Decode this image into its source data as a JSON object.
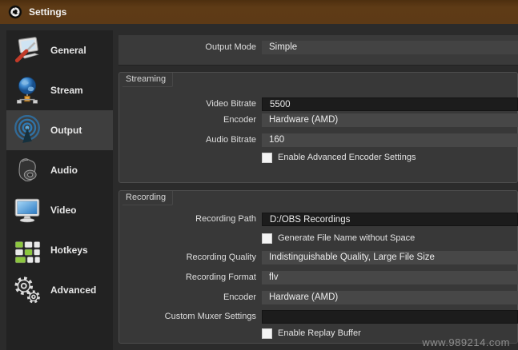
{
  "window": {
    "title": "Settings"
  },
  "sidebar": {
    "items": [
      {
        "label": "General",
        "icon": "general-icon",
        "selected": false
      },
      {
        "label": "Stream",
        "icon": "stream-icon",
        "selected": false
      },
      {
        "label": "Output",
        "icon": "output-icon",
        "selected": true
      },
      {
        "label": "Audio",
        "icon": "audio-icon",
        "selected": false
      },
      {
        "label": "Video",
        "icon": "video-icon",
        "selected": false
      },
      {
        "label": "Hotkeys",
        "icon": "hotkeys-icon",
        "selected": false
      },
      {
        "label": "Advanced",
        "icon": "advanced-icon",
        "selected": false
      }
    ]
  },
  "main": {
    "output_mode": {
      "label": "Output Mode",
      "value": "Simple"
    },
    "streaming": {
      "title": "Streaming",
      "video_bitrate": {
        "label": "Video Bitrate",
        "value": "5500"
      },
      "encoder": {
        "label": "Encoder",
        "value": "Hardware (AMD)"
      },
      "audio_bitrate": {
        "label": "Audio Bitrate",
        "value": "160"
      },
      "advanced_encoder_checkbox": {
        "label": "Enable Advanced Encoder Settings",
        "checked": false
      }
    },
    "recording": {
      "title": "Recording",
      "recording_path": {
        "label": "Recording Path",
        "value": "D:/OBS Recordings"
      },
      "generate_filename_checkbox": {
        "label": "Generate File Name without Space",
        "checked": false
      },
      "recording_quality": {
        "label": "Recording Quality",
        "value": "Indistinguishable Quality, Large File Size"
      },
      "recording_format": {
        "label": "Recording Format",
        "value": "flv"
      },
      "encoder": {
        "label": "Encoder",
        "value": "Hardware (AMD)"
      },
      "custom_muxer": {
        "label": "Custom Muxer Settings",
        "value": ""
      },
      "replay_buffer_checkbox": {
        "label": "Enable Replay Buffer",
        "checked": false
      }
    }
  },
  "watermark": "www.989214.com",
  "colors": {
    "titlebar_brown": "#5d3a16",
    "accent_blue": "#2d7ab5",
    "selected_item_bg": "#3e3e3e",
    "panel_bg": "#383838",
    "input_bg": "#1c1c1c",
    "select_bg": "#474747"
  }
}
